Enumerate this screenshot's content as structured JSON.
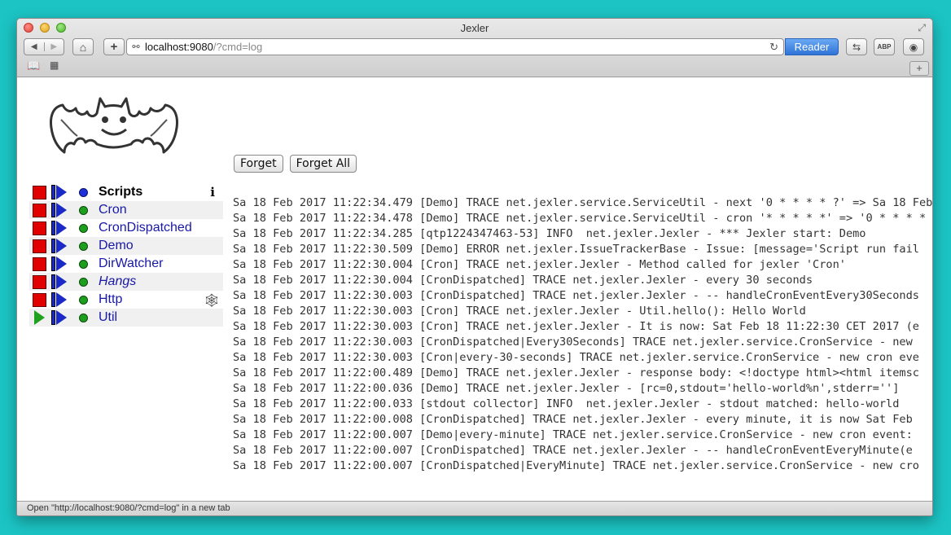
{
  "window": {
    "title": "Jexler"
  },
  "address": {
    "host": "localhost:9080",
    "path": "/?cmd=log"
  },
  "toolbar": {
    "reader_label": "Reader",
    "ext2_label": "ABP"
  },
  "scripts": {
    "header": "Scripts",
    "items": [
      {
        "name": "Cron",
        "state": "running",
        "italic": false,
        "web": false
      },
      {
        "name": "CronDispatched",
        "state": "running",
        "italic": false,
        "web": false
      },
      {
        "name": "Demo",
        "state": "running",
        "italic": false,
        "web": false
      },
      {
        "name": "DirWatcher",
        "state": "running",
        "italic": false,
        "web": false
      },
      {
        "name": "Hangs",
        "state": "running",
        "italic": true,
        "web": false
      },
      {
        "name": "Http",
        "state": "running",
        "italic": false,
        "web": true
      },
      {
        "name": "Util",
        "state": "stopped",
        "italic": false,
        "web": false
      }
    ]
  },
  "actions": {
    "forget": "Forget",
    "forget_all": "Forget All"
  },
  "log": [
    "Sa 18 Feb 2017 11:22:34.479 [Demo] TRACE net.jexler.service.ServiceUtil - next '0 * * * * ?' => Sa 18 Feb",
    "Sa 18 Feb 2017 11:22:34.478 [Demo] TRACE net.jexler.service.ServiceUtil - cron '* * * * *' => '0 * * * * ?'",
    "Sa 18 Feb 2017 11:22:34.285 [qtp1224347463-53] INFO  net.jexler.Jexler - *** Jexler start: Demo",
    "Sa 18 Feb 2017 11:22:30.509 [Demo] ERROR net.jexler.IssueTrackerBase - Issue: [message='Script run fail",
    "Sa 18 Feb 2017 11:22:30.004 [Cron] TRACE net.jexler.Jexler - Method called for jexler 'Cron'",
    "Sa 18 Feb 2017 11:22:30.004 [CronDispatched] TRACE net.jexler.Jexler - every 30 seconds",
    "Sa 18 Feb 2017 11:22:30.003 [CronDispatched] TRACE net.jexler.Jexler - -- handleCronEventEvery30Seconds",
    "Sa 18 Feb 2017 11:22:30.003 [Cron] TRACE net.jexler.Jexler - Util.hello(): Hello World",
    "Sa 18 Feb 2017 11:22:30.003 [Cron] TRACE net.jexler.Jexler - It is now: Sat Feb 18 11:22:30 CET 2017 (e",
    "Sa 18 Feb 2017 11:22:30.003 [CronDispatched|Every30Seconds] TRACE net.jexler.service.CronService - new",
    "Sa 18 Feb 2017 11:22:30.003 [Cron|every-30-seconds] TRACE net.jexler.service.CronService - new cron eve",
    "Sa 18 Feb 2017 11:22:00.489 [Demo] TRACE net.jexler.Jexler - response body: <!doctype html><html itemsc",
    "Sa 18 Feb 2017 11:22:00.036 [Demo] TRACE net.jexler.Jexler - [rc=0,stdout='hello-world%n',stderr='']",
    "Sa 18 Feb 2017 11:22:00.033 [stdout collector] INFO  net.jexler.Jexler - stdout matched: hello-world",
    "Sa 18 Feb 2017 11:22:00.008 [CronDispatched] TRACE net.jexler.Jexler - every minute, it is now Sat Feb",
    "Sa 18 Feb 2017 11:22:00.007 [Demo|every-minute] TRACE net.jexler.service.CronService - new cron event:",
    "Sa 18 Feb 2017 11:22:00.007 [CronDispatched] TRACE net.jexler.Jexler - -- handleCronEventEveryMinute(e",
    "Sa 18 Feb 2017 11:22:00.007 [CronDispatched|EveryMinute] TRACE net.jexler.service.CronService - new cro"
  ],
  "status": "Open \"http://localhost:9080/?cmd=log\" in a new tab",
  "colors": {
    "stop": "#e00000",
    "running_dot": "#1e9e1e",
    "header_dot": "#1d2fd8",
    "restart": "#1a2ac8",
    "start": "#1fa01f"
  }
}
